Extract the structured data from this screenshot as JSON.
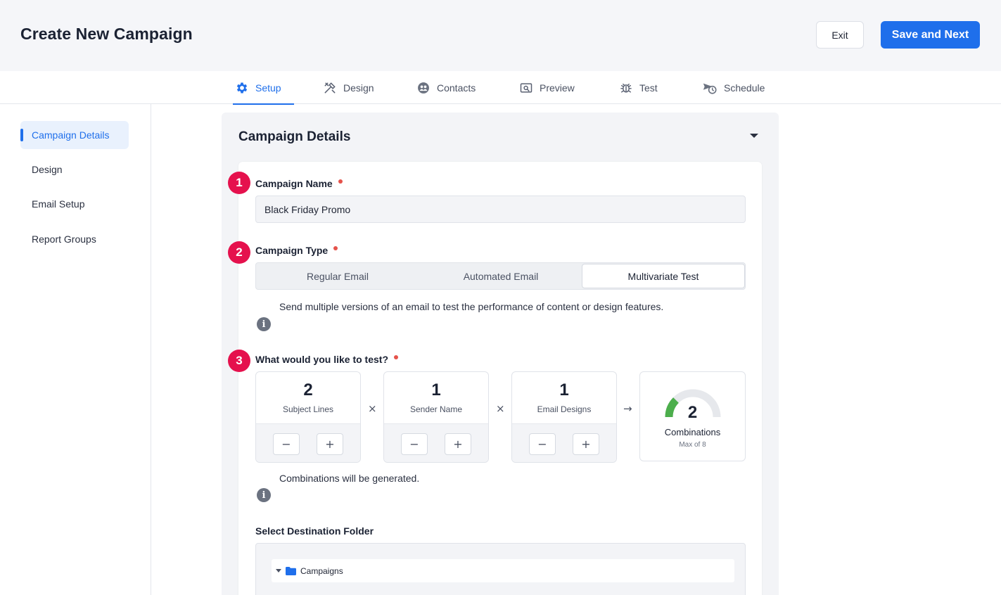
{
  "header": {
    "title": "Create New Campaign",
    "exit_label": "Exit",
    "save_label": "Save and Next"
  },
  "tabs": [
    {
      "label": "Setup",
      "icon": "gear-icon",
      "active": true
    },
    {
      "label": "Design",
      "icon": "tools-icon"
    },
    {
      "label": "Contacts",
      "icon": "contacts-icon"
    },
    {
      "label": "Preview",
      "icon": "preview-icon"
    },
    {
      "label": "Test",
      "icon": "bug-icon"
    },
    {
      "label": "Schedule",
      "icon": "schedule-icon"
    }
  ],
  "sidebar": {
    "items": [
      {
        "label": "Campaign Details",
        "active": true
      },
      {
        "label": "Design"
      },
      {
        "label": "Email Setup"
      },
      {
        "label": "Report Groups"
      }
    ]
  },
  "panel": {
    "title": "Campaign Details",
    "campaign_name": {
      "step": "1",
      "label": "Campaign Name",
      "value": "Black Friday Promo"
    },
    "campaign_type": {
      "step": "2",
      "label": "Campaign Type",
      "options": [
        "Regular Email",
        "Automated Email",
        "Multivariate Test"
      ],
      "selected": "Multivariate Test",
      "info": "Send multiple versions of an email to test the performance of content or design features."
    },
    "test": {
      "step": "3",
      "label": "What would you like to test?",
      "counters": [
        {
          "value": "2",
          "label": "Subject Lines"
        },
        {
          "value": "1",
          "label": "Sender Name"
        },
        {
          "value": "1",
          "label": "Email Designs"
        }
      ],
      "multiply_symbol": "×",
      "arrow_symbol": "→",
      "minus_symbol": "−",
      "plus_symbol": "+",
      "combinations": {
        "value": "2",
        "label": "Combinations",
        "sub": "Max of 8",
        "fraction": 0.25,
        "color": "#4cae4c"
      },
      "info": "Combinations will be generated."
    },
    "destination": {
      "label": "Select Destination Folder",
      "root_folder": "Campaigns"
    }
  },
  "colors": {
    "accent": "#1f6feb",
    "step_badge": "#e5114d",
    "required_dot": "#e5534b"
  }
}
